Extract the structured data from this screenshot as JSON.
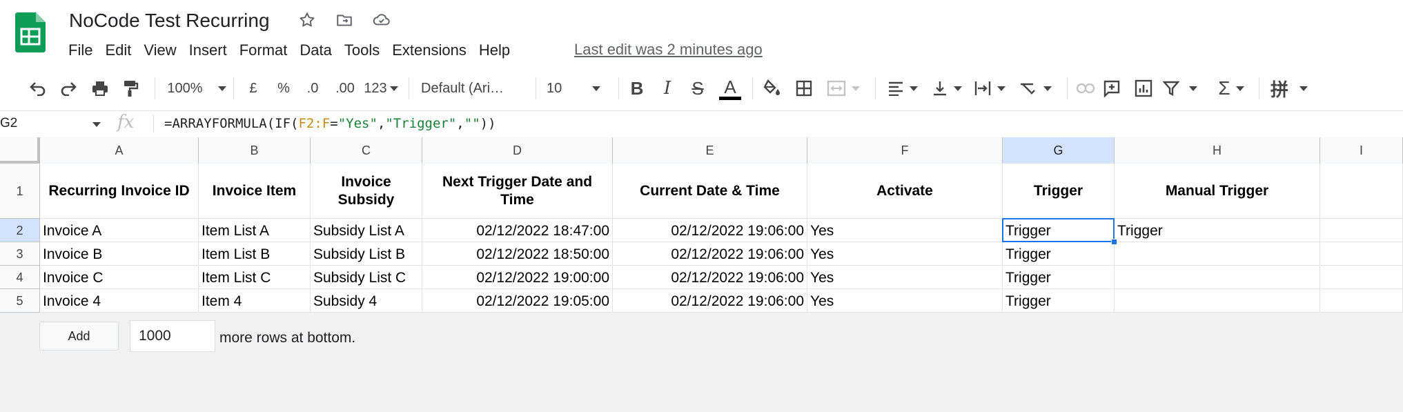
{
  "document": {
    "title": "NoCode Test Recurring"
  },
  "menu": [
    "File",
    "Edit",
    "View",
    "Insert",
    "Format",
    "Data",
    "Tools",
    "Extensions",
    "Help"
  ],
  "last_edit": "Last edit was 2 minutes ago",
  "toolbar": {
    "zoom": "100%",
    "currency": "£",
    "percent": "%",
    "decrease_decimal": ".0",
    "increase_decimal": ".00",
    "more_formats": "123",
    "font": "Default (Ari…",
    "font_size": "10",
    "bold": "B",
    "italic": "I",
    "strikethrough": "S",
    "text_color": "A"
  },
  "formula_bar": {
    "cell_ref": "G2",
    "fx": "fx",
    "formula_parts": [
      "=ARRAYFORMULA(IF(",
      "F2:F",
      "=",
      "\"Yes\"",
      ",",
      "\"Trigger\"",
      ",",
      "\"\"",
      "))"
    ]
  },
  "columns": [
    "A",
    "B",
    "C",
    "D",
    "E",
    "F",
    "G",
    "H",
    "I"
  ],
  "row_numbers": [
    "1",
    "2",
    "3",
    "4",
    "5"
  ],
  "headers": [
    "Recurring Invoice ID",
    "Invoice Item",
    "Invoice Subsidy",
    "Next Trigger Date and Time",
    "Current Date & Time",
    "Activate",
    "Trigger",
    "Manual Trigger",
    ""
  ],
  "rows": [
    [
      "Invoice A",
      "Item List A",
      "Subsidy List A",
      "02/12/2022 18:47:00",
      "02/12/2022 19:06:00",
      "Yes",
      "Trigger",
      "Trigger",
      ""
    ],
    [
      "Invoice B",
      "Item List B",
      "Subsidy List B",
      "02/12/2022 18:50:00",
      "02/12/2022 19:06:00",
      "Yes",
      "Trigger",
      "",
      ""
    ],
    [
      "Invoice C",
      "Item List C",
      "Subsidy List C",
      "02/12/2022 19:00:00",
      "02/12/2022 19:06:00",
      "Yes",
      "Trigger",
      "",
      ""
    ],
    [
      "Invoice 4",
      "Item 4",
      "Subsidy 4",
      "02/12/2022 19:05:00",
      "02/12/2022 19:06:00",
      "Yes",
      "Trigger",
      "",
      ""
    ]
  ],
  "bottom": {
    "add_label": "Add",
    "rows_value": "1000",
    "more_rows_text": "more rows at bottom."
  },
  "colors": {
    "sheets_green": "#0f9d58",
    "selection_blue": "#1a73e8",
    "header_selected": "#d3e3fd"
  }
}
